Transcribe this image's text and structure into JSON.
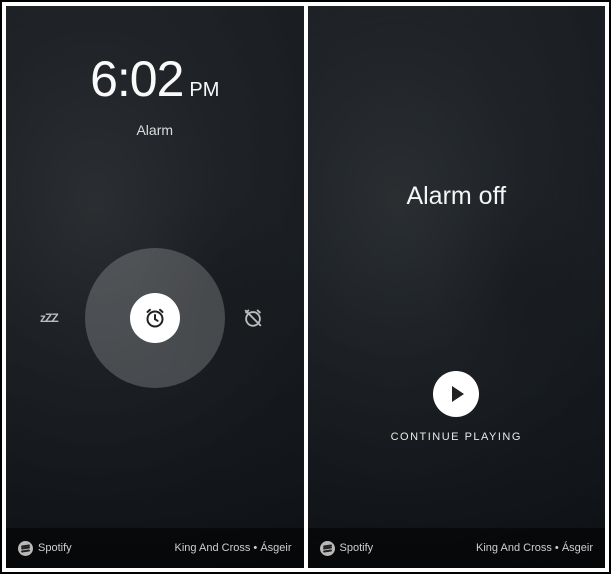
{
  "screen1": {
    "time": "6:02",
    "ampm": "PM",
    "subtitle": "Alarm",
    "snooze_icon_text": "zZZ"
  },
  "screen2": {
    "title": "Alarm off",
    "continue_label": "CONTINUE PLAYING"
  },
  "footer": {
    "provider": "Spotify",
    "now_playing": "King And Cross • Ásgeir"
  }
}
